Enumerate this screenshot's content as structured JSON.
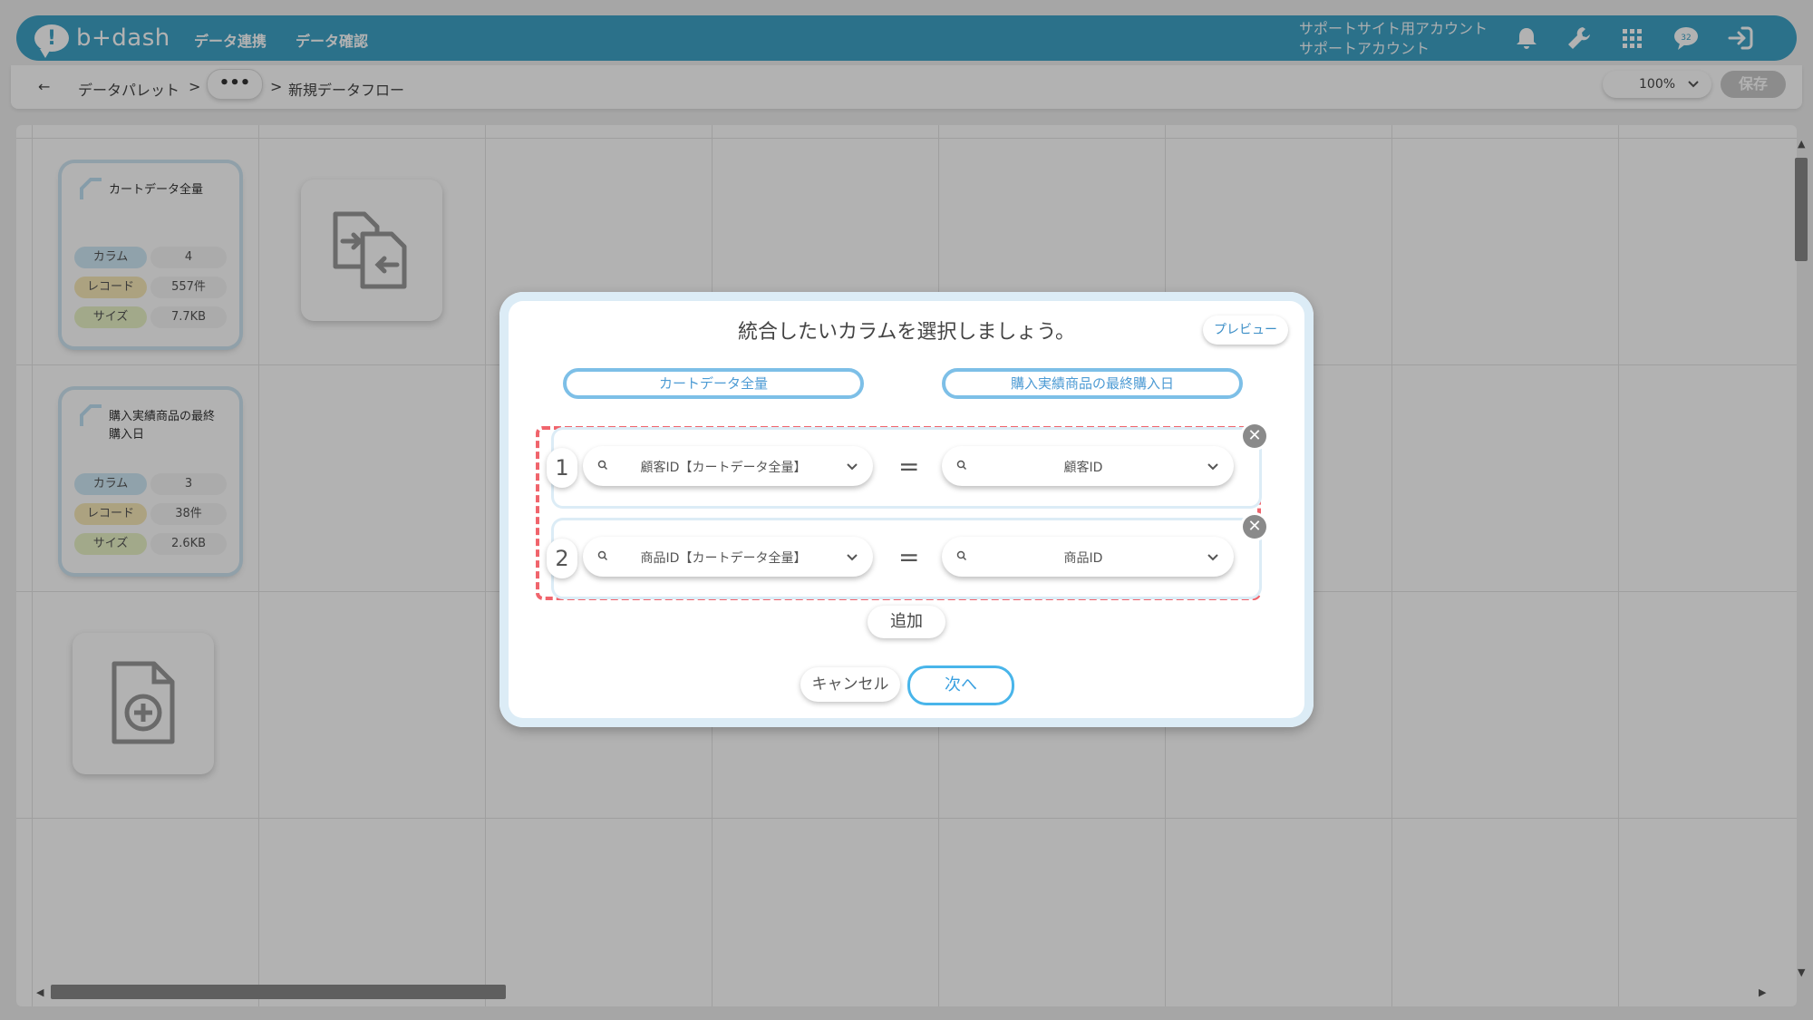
{
  "header": {
    "logo_text": "b+dash",
    "nav": [
      "データ連携",
      "データ確認"
    ],
    "account_line1": "サポートサイト用アカウント",
    "account_line2": "サポートアカウント",
    "icons": [
      "bell-icon",
      "wrench-icon",
      "grid-icon",
      "chat-icon",
      "logout-icon"
    ],
    "chat_badge": "32"
  },
  "toolbar": {
    "back_arrow": "←",
    "breadcrumb_root": "データパレット",
    "sep1": ">",
    "dots": "•••",
    "sep2": ">",
    "current": "新規データフロー",
    "zoom": "100%",
    "save": "保存"
  },
  "canvas": {
    "nodes": [
      {
        "title": "カートデータ全量",
        "rows": [
          {
            "label": "カラム",
            "value": "4"
          },
          {
            "label": "レコード",
            "value": "557件"
          },
          {
            "label": "サイズ",
            "value": "7.7KB"
          }
        ]
      },
      {
        "title": "購入実績商品の最終購入日",
        "rows": [
          {
            "label": "カラム",
            "value": "3"
          },
          {
            "label": "レコード",
            "value": "38件"
          },
          {
            "label": "サイズ",
            "value": "2.6KB"
          }
        ]
      }
    ],
    "tools": [
      "merge-icon",
      "add-file-icon"
    ]
  },
  "dialog": {
    "title": "統合したいカラムを選択しましょう。",
    "preview": "プレビュー",
    "left_table": "カートデータ全量",
    "right_table": "購入実績商品の最終購入日",
    "rows": [
      {
        "num": "1",
        "left": "顧客ID【カートデータ全量】",
        "eq": "=",
        "right": "顧客ID"
      },
      {
        "num": "2",
        "left": "商品ID【カートデータ全量】",
        "eq": "=",
        "right": "商品ID"
      }
    ],
    "close_symbol": "✕",
    "add": "追加",
    "cancel": "キャンセル",
    "next": "次へ"
  },
  "colors": {
    "header_bg": "#3ea2c6",
    "accent_border": "#7dbfe7",
    "dashed_highlight": "#f0646c",
    "next_border": "#49b5ea"
  }
}
